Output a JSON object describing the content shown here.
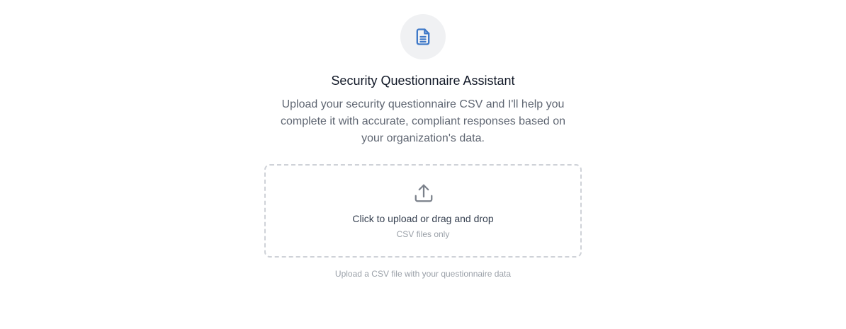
{
  "hero": {
    "icon": "document-icon",
    "icon_color": "#3f79c8",
    "title": "Security Questionnaire Assistant",
    "description": "Upload your security questionnaire CSV and I'll help you complete it with accurate, compliant responses based on your organization's data."
  },
  "upload": {
    "icon": "upload-icon",
    "primary_text": "Click to upload or drag and drop",
    "secondary_text": "CSV files only",
    "hint": "Upload a CSV file with your questionnaire data"
  }
}
